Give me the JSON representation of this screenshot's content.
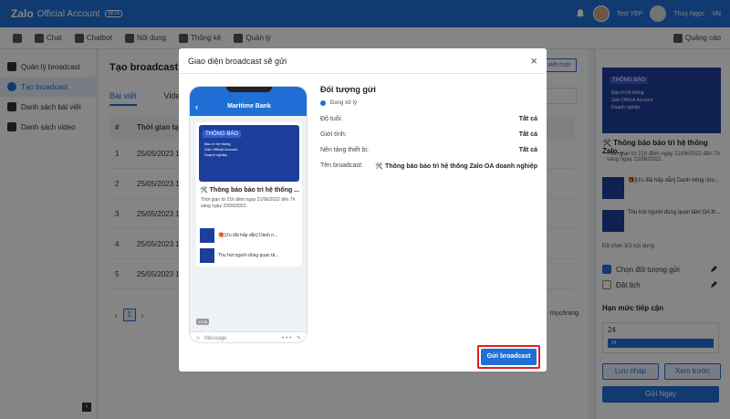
{
  "topbar": {
    "logo": "Zalo",
    "app_name": "Official Account",
    "beta": "BETA",
    "user": "Test YEP",
    "account": "Thuý Ngọc",
    "lang": "VN"
  },
  "nav": {
    "home_icon": "home-icon",
    "items": [
      "Chat",
      "Chatbot",
      "Nội dung",
      "Thống kê",
      "Quản lý"
    ],
    "ads": "Quảng cáo"
  },
  "sidebar": {
    "items": [
      "Quản lý broadcast",
      "Tạo broadcast",
      "Danh sách bài viết",
      "Danh sách video"
    ],
    "active": 1
  },
  "main": {
    "title": "Tạo broadcast",
    "tabs": [
      "Bài viết",
      "Video"
    ],
    "new_button": "ài viết mới",
    "columns": [
      "#",
      "Thời gian tạo"
    ],
    "rows": [
      {
        "n": "1",
        "time": "25/05/2023 1"
      },
      {
        "n": "2",
        "time": "25/05/2023 1"
      },
      {
        "n": "3",
        "time": "25/05/2023 1"
      },
      {
        "n": "4",
        "time": "25/05/2023 1"
      },
      {
        "n": "5",
        "time": "25/05/2023 1"
      }
    ],
    "page": "1",
    "per_page": "mục/trang"
  },
  "right": {
    "thumb_label": "THÔNG BÁO",
    "thumb_text": "Bảo trì hệ thống\nZalo Official Account\nDoanh nghiệp",
    "title": "🛠️ Thông báo bảo trì hệ thống Zalo...",
    "desc": "Thời gian từ 21h đêm ngày 21/06/2022 đến 7h sáng ngày 22/06/2022.",
    "items": [
      "🎁[Ưu đãi hấp dẫn] Danh riêng cho...",
      "Thu hút người dùng quan tâm OA th..."
    ],
    "count": "Đã chọn 3/3 nội dung",
    "checks": [
      {
        "label": "Chọn đối tượng gửi",
        "checked": true
      },
      {
        "label": "Đặt lịch",
        "checked": false
      }
    ],
    "limit_label": "Hạn mức tiếp cận",
    "limit_value": "24",
    "limit_bar": "24",
    "btn_draft": "Lưu nháp",
    "btn_preview": "Xem trước",
    "btn_send_now": "Gửi Ngay"
  },
  "modal": {
    "title": "Giao diện broadcast sẽ gửi",
    "close": "×",
    "phone": {
      "header": "Maritime Bank",
      "card_label": "THÔNG BÁO",
      "card_text": "Bảo trì hệ thống\nZalo Official Account\nDoanh nghiệp",
      "card_title": "🛠️ Thông báo bảo trì hệ thống ...",
      "card_desc": "Thời gian từ 21h đêm ngày 21/06/2022 đến 7h sáng ngày 22/06/2022.",
      "sub1": "🎁[Ưu đãi hấp dẫn] Dành ri...",
      "sub2": "Thu hút người dùng quan tâ...",
      "time": "17:06",
      "message": "Message"
    },
    "audience_title": "Đối tượng gửi",
    "status": "Đang xử lý",
    "fields": [
      {
        "label": "Độ tuổi:",
        "value": "Tất cả"
      },
      {
        "label": "Giới tính:",
        "value": "Tất cả"
      },
      {
        "label": "Nền tảng thiết bị:",
        "value": "Tất cả"
      },
      {
        "label": "Tên broadcast:",
        "value": "🛠️ Thông báo bảo trì hệ thống Zalo OA doanh nghiệp"
      }
    ],
    "send_button": "Gửi broadcast"
  }
}
